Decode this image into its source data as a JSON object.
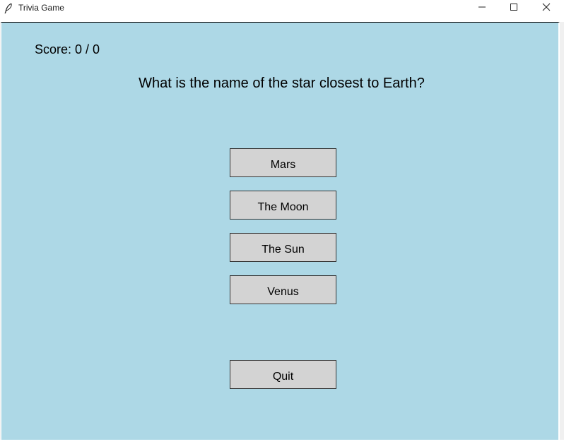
{
  "window": {
    "title": "Trivia Game",
    "app_icon": "feather-icon",
    "controls": {
      "minimize_icon": "minimize-icon",
      "maximize_icon": "maximize-icon",
      "close_icon": "close-icon"
    }
  },
  "game": {
    "score": "Score: 0 / 0",
    "question": "What is the name of the star closest to Earth?",
    "answers": [
      "Mars",
      "The Moon",
      "The Sun",
      "Venus"
    ],
    "quit_label": "Quit"
  },
  "colors": {
    "background": "#add8e6",
    "button": "#d3d3d3",
    "titlebar": "#ffffff"
  }
}
